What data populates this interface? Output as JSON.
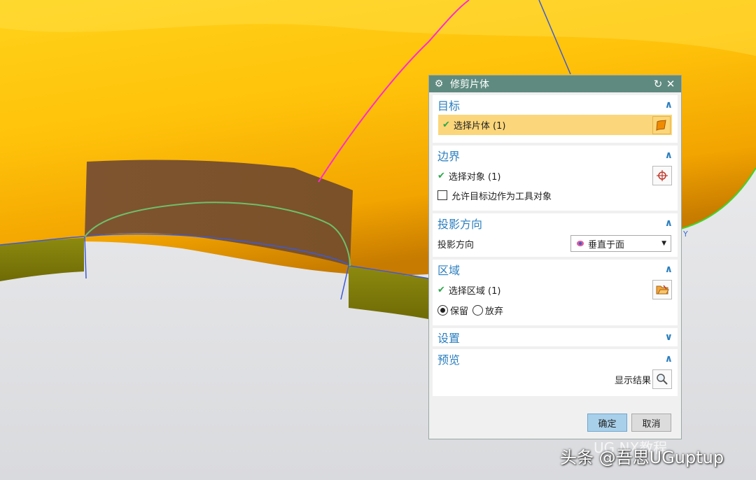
{
  "dialog": {
    "title": "修剪片体",
    "sections": {
      "target": {
        "header": "目标",
        "select_label": "选择片体 (1)"
      },
      "boundary": {
        "header": "边界",
        "select_label": "选择对象 (1)",
        "checkbox_label": "允许目标边作为工具对象"
      },
      "projection": {
        "header": "投影方向",
        "label": "投影方向",
        "dropdown_value": "垂直于面"
      },
      "region": {
        "header": "区域",
        "select_label": "选择区域 (1)",
        "keep_label": "保留",
        "discard_label": "放弃"
      },
      "settings": {
        "header": "设置"
      },
      "preview": {
        "header": "预览",
        "show_result_label": "显示结果"
      }
    },
    "buttons": {
      "ok": "确定",
      "cancel": "取消"
    }
  },
  "viewport": {
    "axis_label": "Y"
  },
  "watermark": {
    "text": "头条 @吾思UGuptup",
    "faint_text": "UG NX教程"
  },
  "colors": {
    "title_bar": "#5f8a7f",
    "section_header": "#2b7fbf",
    "selection_highlight": "#fbd67a",
    "ok_button": "#a8d0ea"
  }
}
